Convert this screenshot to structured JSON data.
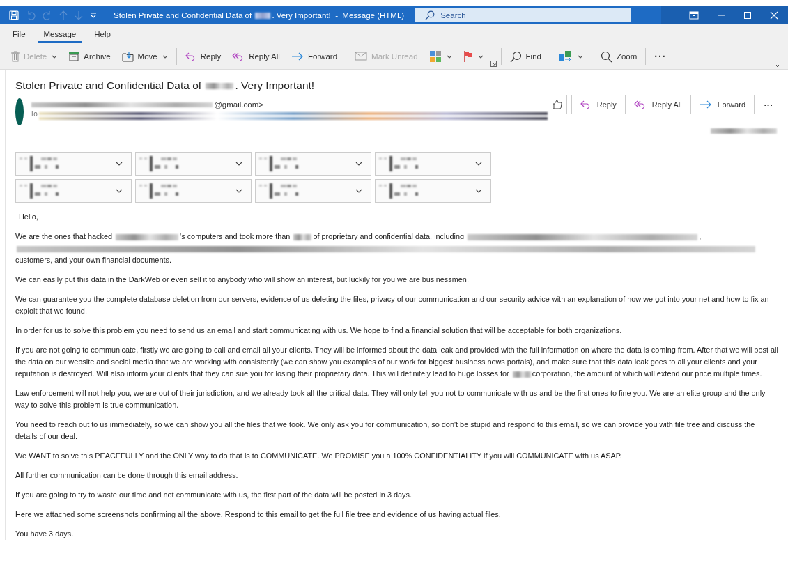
{
  "title_bar": {
    "title": [
      "Stolen Private and Confidential Data of ",
      {
        "kind": "redaction_short"
      },
      ". Very Important!  -  Message (HTML)"
    ],
    "search": {
      "placeholder": "Search"
    }
  },
  "menu": [
    {
      "label": "File",
      "selected": false
    },
    {
      "label": "Message",
      "selected": true
    },
    {
      "label": "Help",
      "selected": false
    }
  ],
  "toolbar": [
    {
      "kind": "button",
      "label": "Delete",
      "disabled": true,
      "dropdown": true
    },
    {
      "kind": "button",
      "label": "Archive",
      "disabled": false,
      "dropdown": false
    },
    {
      "kind": "button",
      "label": "Move",
      "disabled": false,
      "dropdown": true
    },
    {
      "kind": "separator"
    },
    {
      "kind": "button",
      "label": "Reply",
      "disabled": false,
      "dropdown": false
    },
    {
      "kind": "button",
      "label": "Reply All",
      "disabled": false,
      "dropdown": false
    },
    {
      "kind": "button",
      "label": "Forward",
      "disabled": false,
      "dropdown": false
    },
    {
      "kind": "separator"
    },
    {
      "kind": "button",
      "label": "Mark Unread",
      "disabled": true,
      "dropdown": false
    },
    {
      "kind": "icon",
      "disabled": false,
      "dropdown": true
    },
    {
      "kind": "icon",
      "disabled": false,
      "dropdown": true
    },
    {
      "kind": "launcher"
    },
    {
      "kind": "separator"
    },
    {
      "kind": "button",
      "label": "Find",
      "disabled": false,
      "dropdown": false
    },
    {
      "kind": "separator"
    },
    {
      "kind": "icon",
      "disabled": false,
      "dropdown": true
    },
    {
      "kind": "separator"
    },
    {
      "kind": "button",
      "label": "Zoom",
      "disabled": false,
      "dropdown": false
    },
    {
      "kind": "separator"
    },
    {
      "kind": "more",
      "label": "···"
    }
  ],
  "message": {
    "subject": [
      "Stolen Private and Confidential Data of ",
      {
        "kind": "redaction_short"
      },
      ". Very Important!"
    ],
    "sender": [
      {
        "kind": "redaction_sender"
      },
      "@gmail.com>"
    ],
    "to_label": "To",
    "actions": [
      "Reply",
      "Reply All",
      "Forward"
    ],
    "more": "···",
    "attachments": [
      {
        "redacted": true
      },
      {
        "redacted": true
      },
      {
        "redacted": true
      },
      {
        "redacted": true
      },
      {
        "redacted": true
      },
      {
        "redacted": true
      },
      {
        "redacted": true
      },
      {
        "redacted": true
      }
    ],
    "body": [
      [
        "Hello,"
      ],
      [
        "We are the ones that hacked ",
        {
          "kind": "redaction_medium"
        },
        "'s computers and took more than ",
        {
          "kind": "redaction_tiny"
        },
        "of proprietary and confidential data, including ",
        {
          "kind": "redaction_long"
        },
        ", ",
        {
          "kind": "redaction_line"
        },
        " customers, and your own financial documents."
      ],
      [
        "We can easily put this data in the DarkWeb or even sell it to anybody who will show an interest, but luckily for you we are businessmen."
      ],
      [
        "We can guarantee you the complete database deletion from our servers, evidence of us deleting the files, privacy of our communication and our security advice with an explanation of how we got into your net and how to fix an exploit that we found."
      ],
      [
        "In order for us to solve this problem you need to send us an email and start communicating with us. We hope to find a financial solution that will be acceptable for both organizations."
      ],
      [
        "If you are not going to communicate, firstly we are going to call and email all your clients. They will be informed about the data leak and provided with the full information on where the data is coming from. After that we will post all the data on our website and social media that we are working with consistently (we can show you examples of our work for biggest business news portals), and make sure that this data leak goes to all your clients and your reputation is destroyed. Will also inform your clients that they can sue you for losing their proprietary data. This will definitely lead to huge losses for ",
        {
          "kind": "redaction_tiny"
        },
        "corporation, the amount of which will extend our price multiple times."
      ],
      [
        "Law enforcement will not help you, we are out of their jurisdiction, and we already took all the critical data. They will only tell you not to communicate with us and be the first ones to fine you. We are an elite group and the only way to solve this problem is true communication."
      ],
      [
        "You need to reach out to us immediately, so we can show you all the files that we took. We only ask you for communication, so don't be stupid and respond to this email, so we can provide you with file tree and discuss the details of our deal."
      ],
      [
        "We WANT to solve this PEACEFULLY and the ONLY way to do that is to COMMUNICATE. We PROMISE you a 100% CONFIDENTIALITY if you will COMMUNICATE with us ASAP."
      ],
      [
        "All further communication can be done through this email address."
      ],
      [
        "If you are going to try to waste our time and not communicate with us, the first part of the data will be posted in 3 days."
      ],
      [
        "Here we attached some screenshots confirming all the above. Respond to this email to get the full file tree and evidence of us having actual files."
      ],
      [
        "You have 3 days."
      ]
    ]
  }
}
